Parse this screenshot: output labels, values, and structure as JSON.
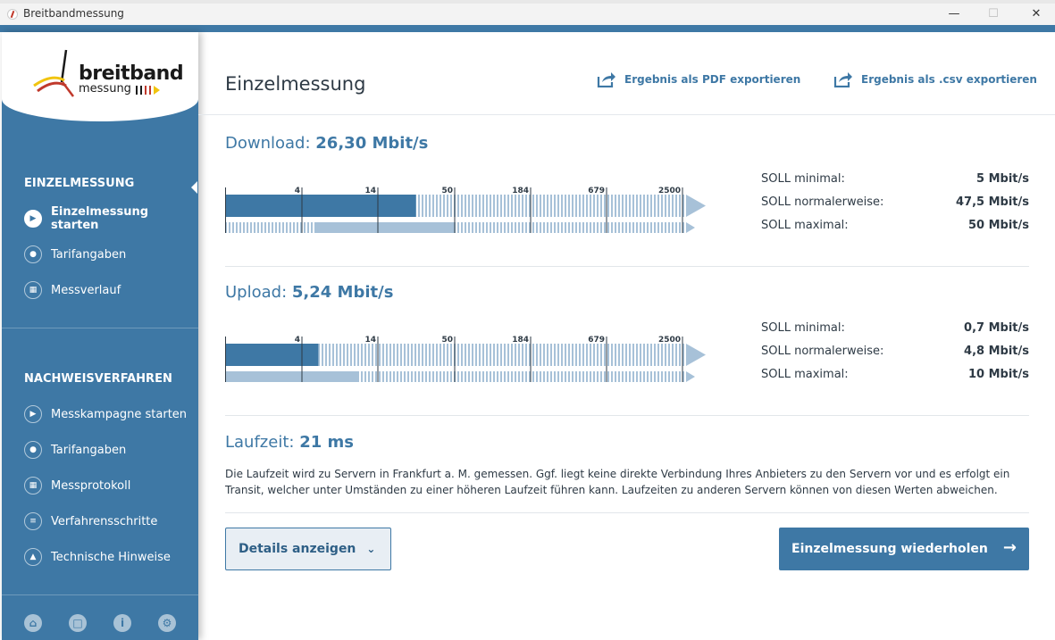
{
  "window": {
    "title": "Breitbandmessung"
  },
  "logo": {
    "name": "breitband",
    "sub": "messung"
  },
  "sidebar": {
    "sections": [
      {
        "title": "EINZELMESSUNG",
        "items": [
          {
            "label": "Einzelmessung starten",
            "icon": "play-icon",
            "active": true
          },
          {
            "label": "Tarifangaben",
            "icon": "user-card-icon"
          },
          {
            "label": "Messverlauf",
            "icon": "calendar-icon"
          }
        ]
      },
      {
        "title": "NACHWEISVERFAHREN",
        "items": [
          {
            "label": "Messkampagne starten",
            "icon": "play-icon"
          },
          {
            "label": "Tarifangaben",
            "icon": "user-card-icon"
          },
          {
            "label": "Messprotokoll",
            "icon": "calendar-icon"
          },
          {
            "label": "Verfahrensschritte",
            "icon": "list-icon"
          },
          {
            "label": "Technische Hinweise",
            "icon": "warning-icon"
          }
        ]
      }
    ],
    "footer_icons": [
      "home-icon",
      "chat-icon",
      "info-icon",
      "gear-icon"
    ]
  },
  "main": {
    "title": "Einzelmessung",
    "export_pdf": "Ergebnis als PDF exportieren",
    "export_csv": "Ergebnis als .csv exportieren",
    "scale_ticks": [
      "4",
      "14",
      "50",
      "184",
      "679",
      "2500"
    ],
    "download": {
      "label": "Download:",
      "value": "26,30 Mbit/s",
      "measured_mbps": 26.3,
      "soll_min_mbps": 5,
      "soll_max_mbps": 50,
      "soll": [
        {
          "label": "SOLL minimal:",
          "value": "5 Mbit/s"
        },
        {
          "label": "SOLL normalerweise:",
          "value": "47,5 Mbit/s"
        },
        {
          "label": "SOLL maximal:",
          "value": "50 Mbit/s"
        }
      ]
    },
    "upload": {
      "label": "Upload:",
      "value": "5,24 Mbit/s",
      "measured_mbps": 5.24,
      "soll_min_mbps": 0.7,
      "soll_max_mbps": 10,
      "soll": [
        {
          "label": "SOLL minimal:",
          "value": "0,7 Mbit/s"
        },
        {
          "label": "SOLL normalerweise:",
          "value": "4,8 Mbit/s"
        },
        {
          "label": "SOLL maximal:",
          "value": "10 Mbit/s"
        }
      ]
    },
    "latency": {
      "label": "Laufzeit:",
      "value": "21 ms",
      "description": "Die Laufzeit wird zu Servern in Frankfurt a. M. gemessen. Ggf. liegt keine direkte Verbindung Ihres Anbieters zu den Servern vor und es erfolgt ein Transit, welcher unter Umständen zu einer höheren Laufzeit führen kann. Laufzeiten zu anderen Servern können von diesen Werten abweichen."
    },
    "details_button": "Details anzeigen",
    "repeat_button": "Einzelmessung wiederholen"
  },
  "colors": {
    "accent": "#3e78a5",
    "bar_measured": "#3e78a5",
    "bar_soll": "#a7c1d8",
    "bar_soll_normal": "#7ca2c2",
    "hatch": "#a7c1d8"
  }
}
